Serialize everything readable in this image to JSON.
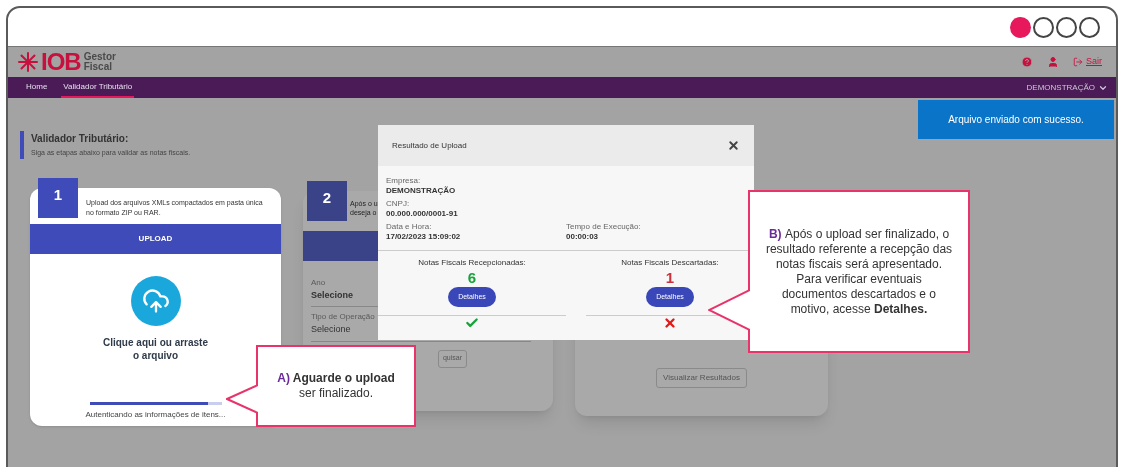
{
  "tutorial_dots": [
    {
      "selected": true
    },
    {
      "selected": false
    },
    {
      "selected": false
    },
    {
      "selected": false
    }
  ],
  "header": {
    "logo": "IOB",
    "logo_subtitle": "Gestor Fiscal",
    "logout": "Sair"
  },
  "nav": {
    "items": [
      {
        "label": "Home",
        "selected": false
      },
      {
        "label": "Validador Tributário",
        "selected": true
      }
    ],
    "company": "DEMONSTRAÇÃO"
  },
  "toast": "Arquivo enviado com sucesso.",
  "page": {
    "title": "Validador Tributário:",
    "subtitle": "Siga as etapas abaixo para validar as notas fiscais."
  },
  "steps": [
    {
      "kind": "upload",
      "number": "1",
      "text": "Upload dos arquivos XMLs compactados em pasta única no formato ZIP ou RAR.",
      "button": "UPLOAD",
      "drop_text": "Clique aqui ou arraste o arquivo",
      "progress": {
        "level": 0.9
      },
      "status": "Autenticando as informações de itens..."
    },
    {
      "kind": "filter",
      "number": "2",
      "text_lines": [
        "Após o u",
        "deseja o"
      ],
      "fields": [
        {
          "label": "Ano",
          "value": "Selecione"
        },
        {
          "label": "Tipo de Operação",
          "value": "Selecione"
        }
      ],
      "button": "quisar"
    },
    {
      "kind": "results",
      "button": "Visualizar Resultados"
    }
  ],
  "modal": {
    "title": "Resultado de Upload",
    "fields": [
      {
        "label": "Empresa:",
        "value": "DEMONSTRAÇÃO"
      },
      {
        "label": "CNPJ:",
        "value": "00.000.000/0001-91"
      },
      {
        "label": "Data e Hora:",
        "value": "17/02/2023 15:09:02"
      },
      {
        "label": "Tempo de Execução:",
        "value": "00:00:03"
      }
    ],
    "results": [
      {
        "label": "Notas Fiscais Recepcionadas:",
        "count": "6",
        "kind": "received",
        "button": "Detalhes"
      },
      {
        "label": "Notas Fiscais Descartadas:",
        "count": "1",
        "kind": "discarded",
        "button": "Detalhes"
      }
    ]
  },
  "callouts": [
    {
      "marker": "A)",
      "text": "**Aguarde o upload** ser finalizado."
    },
    {
      "marker": "B)",
      "text": "Após o upload ser finalizado, o resultado referente a recepção das notas fiscais será apresentado. Para verificar eventuais documentos descartados e o motivo, acesse **Detalhes.**"
    }
  ]
}
